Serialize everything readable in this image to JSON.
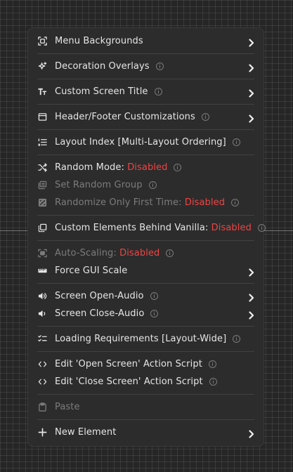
{
  "menu": {
    "items": [
      {
        "id": "menu-backgrounds",
        "label": "Menu Backgrounds",
        "icon": "menu-backgrounds-icon",
        "info": false,
        "submenu": true,
        "disabled": false
      },
      {
        "sep": true
      },
      {
        "id": "decoration-overlays",
        "label": "Decoration Overlays",
        "icon": "sparkle-icon",
        "info": true,
        "submenu": true,
        "disabled": false
      },
      {
        "sep": true
      },
      {
        "id": "custom-screen-title",
        "label": "Custom Screen Title",
        "icon": "text-icon",
        "info": true,
        "submenu": true,
        "disabled": false
      },
      {
        "sep": true
      },
      {
        "id": "header-footer-customizations",
        "label": "Header/Footer Customizations",
        "icon": "header-footer-icon",
        "info": true,
        "submenu": true,
        "disabled": false
      },
      {
        "sep": true
      },
      {
        "id": "layout-index",
        "label": "Layout Index [Multi-Layout Ordering]",
        "icon": "ordered-list-icon",
        "info": true,
        "submenu": false,
        "disabled": false
      },
      {
        "sep": true
      },
      {
        "id": "random-mode",
        "label": "Random Mode: ",
        "value": "Disabled",
        "icon": "shuffle-icon",
        "info": true,
        "submenu": false,
        "disabled": false
      },
      {
        "id": "set-random-group",
        "label": "Set Random Group",
        "icon": "group-icon",
        "info": true,
        "submenu": false,
        "disabled": true
      },
      {
        "id": "randomize-only-first-time",
        "label": "Randomize Only First Time: ",
        "value": "Disabled",
        "icon": "dice-icon",
        "info": true,
        "submenu": false,
        "disabled": true
      },
      {
        "sep": true
      },
      {
        "id": "custom-elements-behind-vanilla",
        "label": "Custom Elements Behind Vanilla: ",
        "value": "Disabled",
        "icon": "layers-icon",
        "info": true,
        "submenu": false,
        "disabled": false
      },
      {
        "sep": true
      },
      {
        "id": "auto-scaling",
        "label": "Auto-Scaling: ",
        "value": "Disabled",
        "icon": "auto-scale-icon",
        "info": true,
        "submenu": false,
        "disabled": true
      },
      {
        "id": "force-gui-scale",
        "label": "Force GUI Scale",
        "icon": "ruler-icon",
        "info": false,
        "submenu": true,
        "disabled": false
      },
      {
        "sep": true
      },
      {
        "id": "screen-open-audio",
        "label": "Screen Open-Audio",
        "icon": "speaker-icon",
        "info": true,
        "submenu": true,
        "disabled": false
      },
      {
        "id": "screen-close-audio",
        "label": "Screen Close-Audio",
        "icon": "speaker-close-icon",
        "info": true,
        "submenu": true,
        "disabled": false
      },
      {
        "sep": true
      },
      {
        "id": "loading-requirements",
        "label": "Loading Requirements [Layout-Wide]",
        "icon": "checklist-icon",
        "info": true,
        "submenu": false,
        "disabled": false
      },
      {
        "sep": true
      },
      {
        "id": "edit-open-screen-script",
        "label": "Edit 'Open Screen' Action Script",
        "icon": "code-icon",
        "info": true,
        "submenu": false,
        "disabled": false
      },
      {
        "id": "edit-close-screen-script",
        "label": "Edit 'Close Screen' Action Script",
        "icon": "code-icon",
        "info": true,
        "submenu": false,
        "disabled": false
      },
      {
        "sep": true
      },
      {
        "id": "paste",
        "label": "Paste",
        "icon": "clipboard-icon",
        "info": false,
        "submenu": false,
        "disabled": true
      },
      {
        "sep": true
      },
      {
        "id": "new-element",
        "label": "New Element",
        "icon": "plus-icon",
        "info": false,
        "submenu": true,
        "disabled": false
      }
    ]
  },
  "colors": {
    "accent_disabled_value": "#ef4444",
    "menu_bg": "#2c2c2c"
  }
}
